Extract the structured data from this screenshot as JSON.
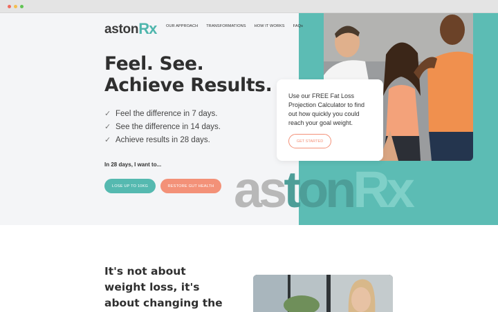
{
  "brand": {
    "word": "aston",
    "mark": "Rx"
  },
  "nav": {
    "items": [
      {
        "label": "OUR APPROACH"
      },
      {
        "label": "TRANSFORMATIONS"
      },
      {
        "label": "HOW IT WORKS"
      },
      {
        "label": "FAQs"
      }
    ]
  },
  "hero": {
    "headline_line1": "Feel. See.",
    "headline_line2": "Achieve Results.",
    "checks": [
      "Feel the difference in 7 days.",
      "See the difference in 14 days.",
      "Achieve results in 28 days."
    ],
    "lead": "In 28 days, I want to...",
    "cta_primary": "LOSE UP TO 10KG",
    "cta_secondary": "RESTORE GUT HEALTH"
  },
  "callout": {
    "text": "Use our FREE Fat Loss Projection Calculator to find out how quickly you could reach your goal weight.",
    "button": "GET STARTED"
  },
  "watermark": {
    "part1": "as",
    "part2": "ton",
    "part3": "Rx"
  },
  "section2": {
    "title": "It's not about weight loss, it's about changing the way your"
  },
  "colors": {
    "teal": "#5cbcb4",
    "coral": "#f39178",
    "text": "#2f2f2f"
  }
}
